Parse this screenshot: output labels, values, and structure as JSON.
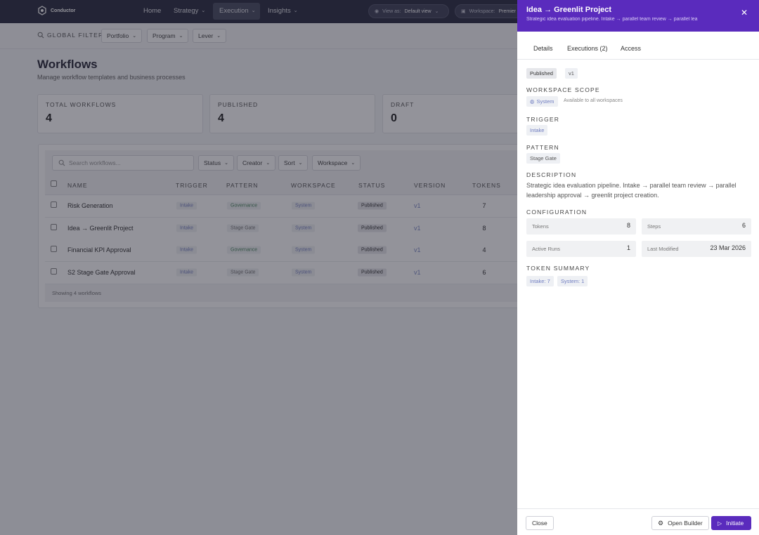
{
  "app": {
    "name": "Conductor"
  },
  "nav": {
    "items": [
      {
        "label": "Home"
      },
      {
        "label": "Strategy"
      },
      {
        "label": "Execution"
      },
      {
        "label": "Insights"
      }
    ],
    "view_as_label": "View as:",
    "view_as_value": "Default view",
    "workspace_label": "Workspace:",
    "workspace_value": "Premier"
  },
  "filters": {
    "label": "GLOBAL FILTERS",
    "items": [
      {
        "label": "Portfolio"
      },
      {
        "label": "Program"
      },
      {
        "label": "Lever"
      }
    ]
  },
  "page": {
    "title": "Workflows",
    "subtitle": "Manage workflow templates and business processes"
  },
  "stats": [
    {
      "label": "TOTAL WORKFLOWS",
      "value": "4"
    },
    {
      "label": "PUBLISHED",
      "value": "4"
    },
    {
      "label": "DRAFT",
      "value": "0"
    }
  ],
  "table": {
    "search_placeholder": "Search workflows...",
    "dropdowns": [
      {
        "label": "Status"
      },
      {
        "label": "Creator"
      },
      {
        "label": "Sort"
      },
      {
        "label": "Workspace"
      }
    ],
    "columns": [
      "NAME",
      "TRIGGER",
      "PATTERN",
      "WORKSPACE",
      "STATUS",
      "VERSION",
      "TOKENS"
    ],
    "rows": [
      {
        "name": "Risk Generation",
        "trigger": "Intake",
        "pattern": "Governance",
        "workspace": "System",
        "status": "Published",
        "version": "v1",
        "tokens": "7"
      },
      {
        "name": "Idea → Greenlit Project",
        "trigger": "Intake",
        "pattern": "Stage Gate",
        "workspace": "System",
        "status": "Published",
        "version": "v1",
        "tokens": "8"
      },
      {
        "name": "Financial KPI Approval",
        "trigger": "Intake",
        "pattern": "Governance",
        "workspace": "System",
        "status": "Published",
        "version": "v1",
        "tokens": "4"
      },
      {
        "name": "S2 Stage Gate Approval",
        "trigger": "Intake",
        "pattern": "Stage Gate",
        "workspace": "System",
        "status": "Published",
        "version": "v1",
        "tokens": "6"
      }
    ],
    "footer": "Showing 4 workflows"
  },
  "drawer": {
    "title": "Idea → Greenlit Project",
    "subtitle": "Strategic idea evaluation pipeline. Intake → parallel team review → parallel lea",
    "tabs": [
      {
        "label": "Details"
      },
      {
        "label": "Executions (2)"
      },
      {
        "label": "Access"
      }
    ],
    "status": "Published",
    "version": "v1",
    "workspace_scope_label": "WORKSPACE SCOPE",
    "workspace_scope_value": "System",
    "workspace_scope_note": "Available to all workspaces",
    "trigger_label": "TRIGGER",
    "trigger_value": "Intake",
    "pattern_label": "PATTERN",
    "pattern_value": "Stage Gate",
    "description_label": "DESCRIPTION",
    "description": "Strategic idea evaluation pipeline. Intake → parallel team review → parallel leadership approval → greenlit project creation.",
    "configuration_label": "CONFIGURATION",
    "config": [
      {
        "key": "Tokens",
        "value": "8"
      },
      {
        "key": "Steps",
        "value": "6"
      },
      {
        "key": "Active Runs",
        "value": "1"
      },
      {
        "key": "Last Modified",
        "value": "23 Mar 2026"
      }
    ],
    "token_summary_label": "TOKEN SUMMARY",
    "token_summary": [
      {
        "label": "Intake: 7"
      },
      {
        "label": "System: 1"
      }
    ],
    "footer": {
      "close": "Close",
      "open_builder": "Open Builder",
      "initiate": "Initiate"
    }
  },
  "colors": {
    "nav_bg": "#2d2f42",
    "drawer_accent": "#5a2bbd",
    "overlay": "rgba(25,26,40,0.47)"
  }
}
